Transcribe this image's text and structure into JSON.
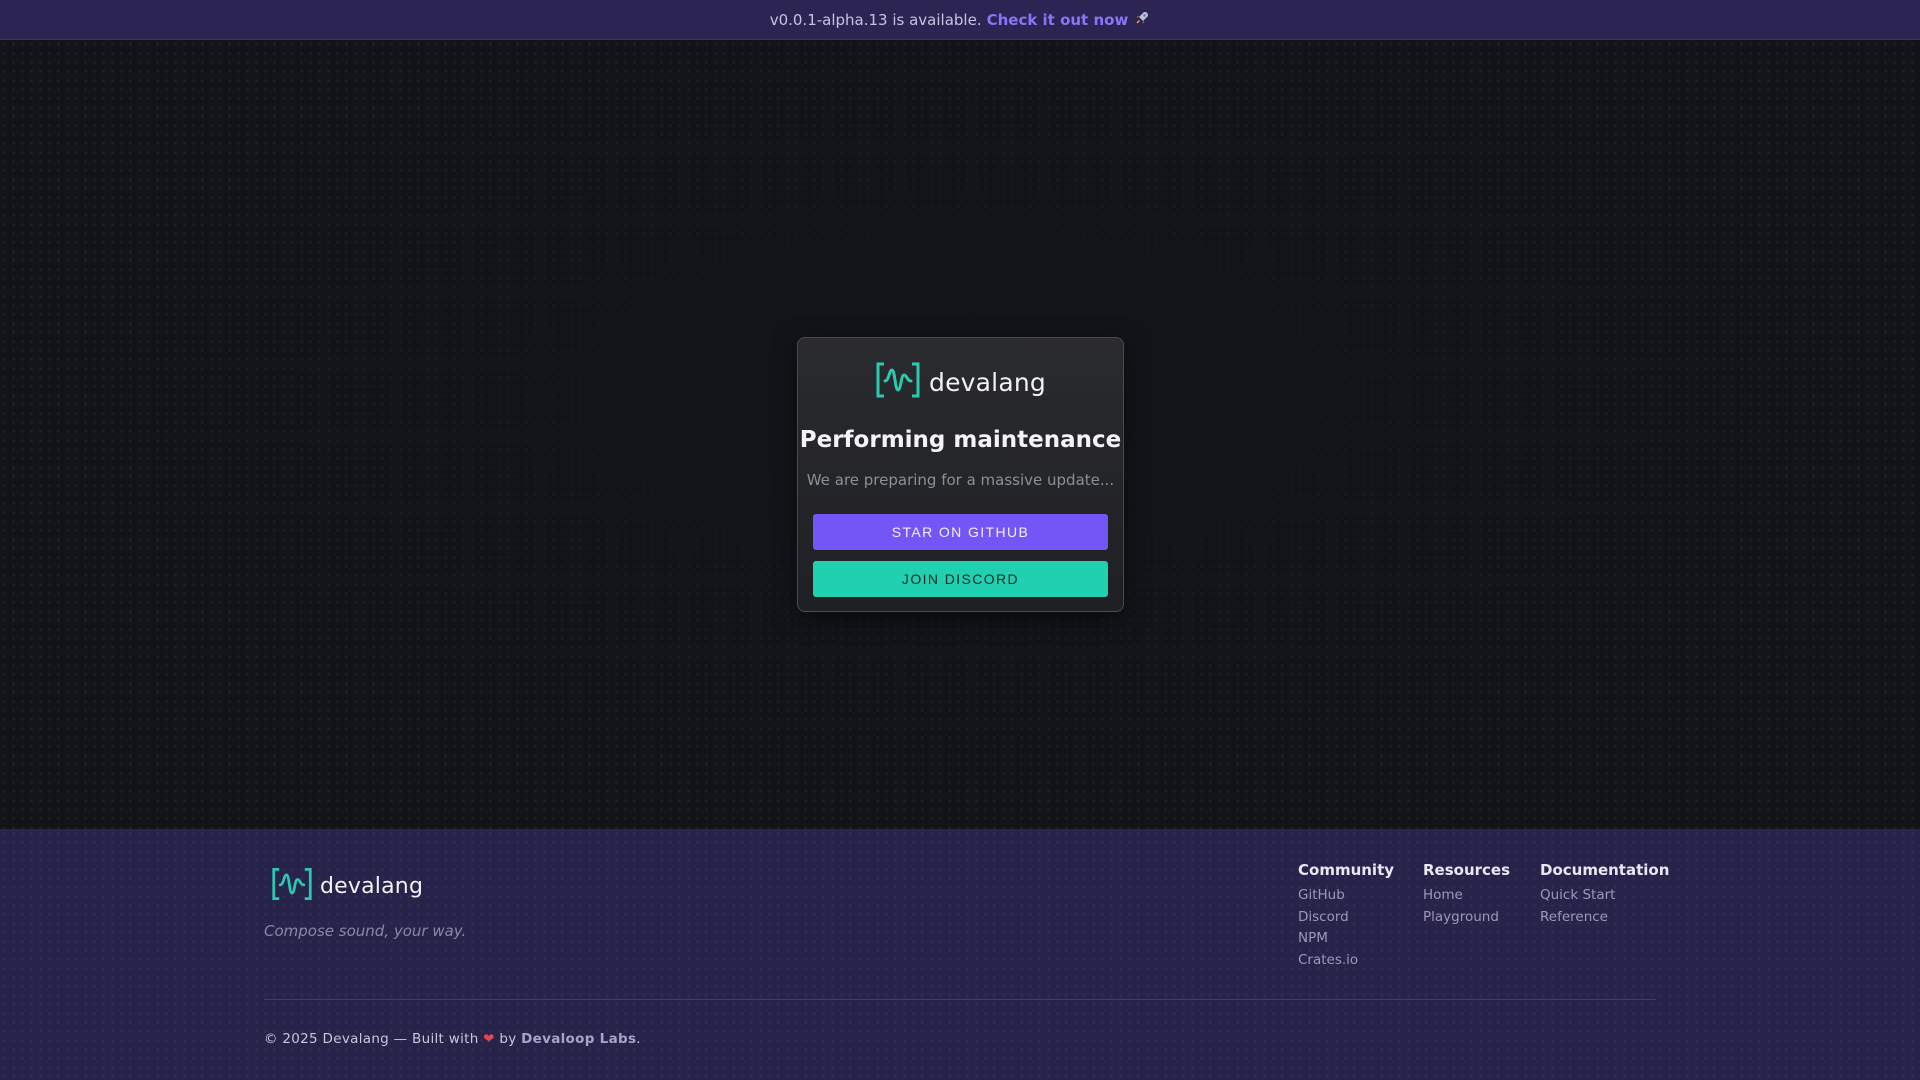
{
  "announcement": {
    "text": "v0.0.1-alpha.13 is available.",
    "link_label": "Check it out now",
    "rocket_icon": "rocket-icon"
  },
  "brand": {
    "name": "devalang",
    "logo_icon": "waveform-bracket-icon",
    "accent": "#1fd1b1"
  },
  "card": {
    "title": "Performing maintenance",
    "subtitle": "We are preparing for a massive update...",
    "github_button": "STAR ON GITHUB",
    "discord_button": "JOIN DISCORD",
    "github_color": "#7257f6",
    "discord_color": "#1fd1b1"
  },
  "footer": {
    "tagline": "Compose sound, your way.",
    "columns": [
      {
        "title": "Community",
        "links": [
          "GitHub",
          "Discord",
          "NPM",
          "Crates.io"
        ]
      },
      {
        "title": "Resources",
        "links": [
          "Home",
          "Playground"
        ]
      },
      {
        "title": "Documentation",
        "links": [
          "Quick Start",
          "Reference"
        ]
      }
    ],
    "copyright_prefix": "© 2025 Devalang — Built with",
    "heart": "❤",
    "copyright_by": "by",
    "labs": "Devaloop Labs",
    "period": "."
  }
}
